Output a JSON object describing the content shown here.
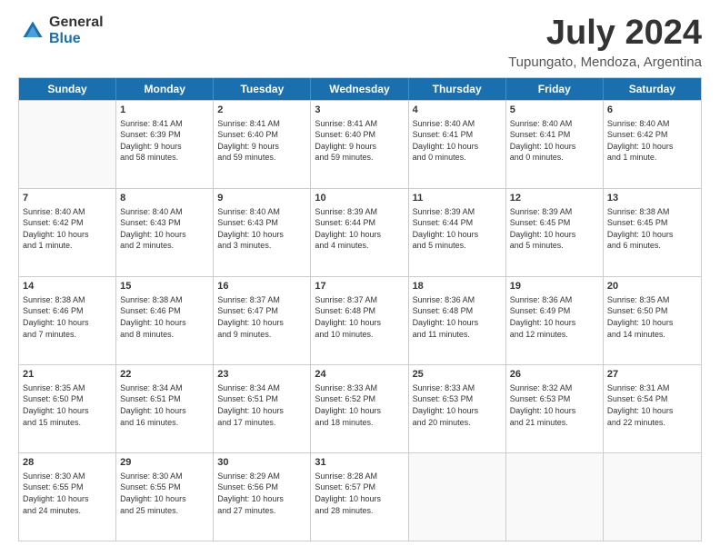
{
  "logo": {
    "general": "General",
    "blue": "Blue"
  },
  "title": "July 2024",
  "subtitle": "Tupungato, Mendoza, Argentina",
  "headers": [
    "Sunday",
    "Monday",
    "Tuesday",
    "Wednesday",
    "Thursday",
    "Friday",
    "Saturday"
  ],
  "rows": [
    [
      {
        "day": "",
        "lines": []
      },
      {
        "day": "1",
        "lines": [
          "Sunrise: 8:41 AM",
          "Sunset: 6:39 PM",
          "Daylight: 9 hours",
          "and 58 minutes."
        ]
      },
      {
        "day": "2",
        "lines": [
          "Sunrise: 8:41 AM",
          "Sunset: 6:40 PM",
          "Daylight: 9 hours",
          "and 59 minutes."
        ]
      },
      {
        "day": "3",
        "lines": [
          "Sunrise: 8:41 AM",
          "Sunset: 6:40 PM",
          "Daylight: 9 hours",
          "and 59 minutes."
        ]
      },
      {
        "day": "4",
        "lines": [
          "Sunrise: 8:40 AM",
          "Sunset: 6:41 PM",
          "Daylight: 10 hours",
          "and 0 minutes."
        ]
      },
      {
        "day": "5",
        "lines": [
          "Sunrise: 8:40 AM",
          "Sunset: 6:41 PM",
          "Daylight: 10 hours",
          "and 0 minutes."
        ]
      },
      {
        "day": "6",
        "lines": [
          "Sunrise: 8:40 AM",
          "Sunset: 6:42 PM",
          "Daylight: 10 hours",
          "and 1 minute."
        ]
      }
    ],
    [
      {
        "day": "7",
        "lines": [
          "Sunrise: 8:40 AM",
          "Sunset: 6:42 PM",
          "Daylight: 10 hours",
          "and 1 minute."
        ]
      },
      {
        "day": "8",
        "lines": [
          "Sunrise: 8:40 AM",
          "Sunset: 6:43 PM",
          "Daylight: 10 hours",
          "and 2 minutes."
        ]
      },
      {
        "day": "9",
        "lines": [
          "Sunrise: 8:40 AM",
          "Sunset: 6:43 PM",
          "Daylight: 10 hours",
          "and 3 minutes."
        ]
      },
      {
        "day": "10",
        "lines": [
          "Sunrise: 8:39 AM",
          "Sunset: 6:44 PM",
          "Daylight: 10 hours",
          "and 4 minutes."
        ]
      },
      {
        "day": "11",
        "lines": [
          "Sunrise: 8:39 AM",
          "Sunset: 6:44 PM",
          "Daylight: 10 hours",
          "and 5 minutes."
        ]
      },
      {
        "day": "12",
        "lines": [
          "Sunrise: 8:39 AM",
          "Sunset: 6:45 PM",
          "Daylight: 10 hours",
          "and 5 minutes."
        ]
      },
      {
        "day": "13",
        "lines": [
          "Sunrise: 8:38 AM",
          "Sunset: 6:45 PM",
          "Daylight: 10 hours",
          "and 6 minutes."
        ]
      }
    ],
    [
      {
        "day": "14",
        "lines": [
          "Sunrise: 8:38 AM",
          "Sunset: 6:46 PM",
          "Daylight: 10 hours",
          "and 7 minutes."
        ]
      },
      {
        "day": "15",
        "lines": [
          "Sunrise: 8:38 AM",
          "Sunset: 6:46 PM",
          "Daylight: 10 hours",
          "and 8 minutes."
        ]
      },
      {
        "day": "16",
        "lines": [
          "Sunrise: 8:37 AM",
          "Sunset: 6:47 PM",
          "Daylight: 10 hours",
          "and 9 minutes."
        ]
      },
      {
        "day": "17",
        "lines": [
          "Sunrise: 8:37 AM",
          "Sunset: 6:48 PM",
          "Daylight: 10 hours",
          "and 10 minutes."
        ]
      },
      {
        "day": "18",
        "lines": [
          "Sunrise: 8:36 AM",
          "Sunset: 6:48 PM",
          "Daylight: 10 hours",
          "and 11 minutes."
        ]
      },
      {
        "day": "19",
        "lines": [
          "Sunrise: 8:36 AM",
          "Sunset: 6:49 PM",
          "Daylight: 10 hours",
          "and 12 minutes."
        ]
      },
      {
        "day": "20",
        "lines": [
          "Sunrise: 8:35 AM",
          "Sunset: 6:50 PM",
          "Daylight: 10 hours",
          "and 14 minutes."
        ]
      }
    ],
    [
      {
        "day": "21",
        "lines": [
          "Sunrise: 8:35 AM",
          "Sunset: 6:50 PM",
          "Daylight: 10 hours",
          "and 15 minutes."
        ]
      },
      {
        "day": "22",
        "lines": [
          "Sunrise: 8:34 AM",
          "Sunset: 6:51 PM",
          "Daylight: 10 hours",
          "and 16 minutes."
        ]
      },
      {
        "day": "23",
        "lines": [
          "Sunrise: 8:34 AM",
          "Sunset: 6:51 PM",
          "Daylight: 10 hours",
          "and 17 minutes."
        ]
      },
      {
        "day": "24",
        "lines": [
          "Sunrise: 8:33 AM",
          "Sunset: 6:52 PM",
          "Daylight: 10 hours",
          "and 18 minutes."
        ]
      },
      {
        "day": "25",
        "lines": [
          "Sunrise: 8:33 AM",
          "Sunset: 6:53 PM",
          "Daylight: 10 hours",
          "and 20 minutes."
        ]
      },
      {
        "day": "26",
        "lines": [
          "Sunrise: 8:32 AM",
          "Sunset: 6:53 PM",
          "Daylight: 10 hours",
          "and 21 minutes."
        ]
      },
      {
        "day": "27",
        "lines": [
          "Sunrise: 8:31 AM",
          "Sunset: 6:54 PM",
          "Daylight: 10 hours",
          "and 22 minutes."
        ]
      }
    ],
    [
      {
        "day": "28",
        "lines": [
          "Sunrise: 8:30 AM",
          "Sunset: 6:55 PM",
          "Daylight: 10 hours",
          "and 24 minutes."
        ]
      },
      {
        "day": "29",
        "lines": [
          "Sunrise: 8:30 AM",
          "Sunset: 6:55 PM",
          "Daylight: 10 hours",
          "and 25 minutes."
        ]
      },
      {
        "day": "30",
        "lines": [
          "Sunrise: 8:29 AM",
          "Sunset: 6:56 PM",
          "Daylight: 10 hours",
          "and 27 minutes."
        ]
      },
      {
        "day": "31",
        "lines": [
          "Sunrise: 8:28 AM",
          "Sunset: 6:57 PM",
          "Daylight: 10 hours",
          "and 28 minutes."
        ]
      },
      {
        "day": "",
        "lines": []
      },
      {
        "day": "",
        "lines": []
      },
      {
        "day": "",
        "lines": []
      }
    ]
  ]
}
